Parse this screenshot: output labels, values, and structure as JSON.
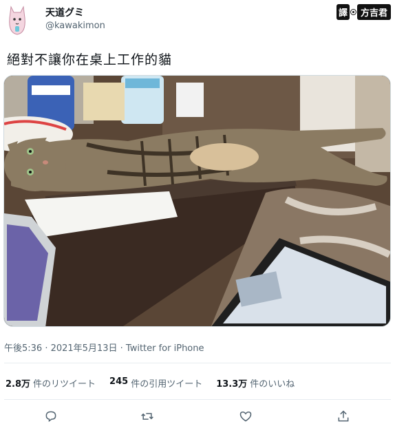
{
  "tweet": {
    "display_name": "天道グミ",
    "handle": "@kawakimon",
    "text": "絕對不讓你在桌上工作的貓",
    "timestamp": "午後5:36 · 2021年5月13日",
    "source": "Twitter for iPhone"
  },
  "translator_badge": {
    "label_a": "譯",
    "label_b": "方吉君"
  },
  "stats": [
    {
      "count": "2.8万",
      "label": "件のリツイート"
    },
    {
      "count": "245",
      "label": "件の引用ツイート"
    },
    {
      "count": "13.3万",
      "label": "件のいいね"
    }
  ],
  "actions": [
    {
      "icon": "reply-icon"
    },
    {
      "icon": "retweet-icon"
    },
    {
      "icon": "like-icon"
    },
    {
      "icon": "share-icon"
    }
  ],
  "colors": {
    "text": "#0f1419",
    "muted": "#536471",
    "divider": "#e6ecf0"
  }
}
